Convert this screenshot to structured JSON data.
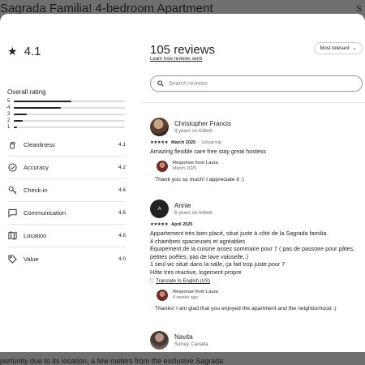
{
  "background": {
    "title": "Sagrada Familia! 4-bedroom Apartment",
    "share_label": "S",
    "bottom_text": "portunity due to its location, a few meters from the exclusive Sagrada"
  },
  "summary": {
    "overall_rating": "4.1",
    "overall_label": "Overall rating",
    "distribution": [
      {
        "stars": "5",
        "fraction": 0.52
      },
      {
        "stars": "4",
        "fraction": 0.42
      },
      {
        "stars": "3",
        "fraction": 0.12
      },
      {
        "stars": "2",
        "fraction": 0.08
      },
      {
        "stars": "1",
        "fraction": 0.03
      }
    ],
    "categories": [
      {
        "label": "Cleanliness",
        "value": "4.1",
        "icon": "spray-bottle-icon"
      },
      {
        "label": "Accuracy",
        "value": "4.2",
        "icon": "check-circle-icon"
      },
      {
        "label": "Check-in",
        "value": "4.6",
        "icon": "key-icon"
      },
      {
        "label": "Communication",
        "value": "4.6",
        "icon": "message-icon"
      },
      {
        "label": "Location",
        "value": "4.8",
        "icon": "map-icon"
      },
      {
        "label": "Value",
        "value": "4.0",
        "icon": "tag-icon"
      }
    ]
  },
  "reviews_panel": {
    "count_title": "105 reviews",
    "learn_link": "Learn how reviews work",
    "sort_label": "Most relevant",
    "search_placeholder": "Search reviews"
  },
  "reviews": [
    {
      "name": "Christopher Francis",
      "subtitle": "4 years on Airbnb",
      "stars": "★★★★★",
      "date": "March 2025",
      "trip_type": "· Group trip",
      "body": "Amazing flexible care free stay great hostess",
      "response": {
        "from": "Response from Laura",
        "when": "March 2025",
        "text": "Thank you so much! I appreciate it :)"
      }
    },
    {
      "name": "Annie",
      "initial": "A",
      "subtitle": "6 years on Airbnb",
      "stars": "★★★★★",
      "date": "April 2025",
      "body_lines": [
        "Appartement très bien placé, situé juste à côté de la Sagrada familia.",
        "4 chambres spacieuses et agréables",
        "Équipement de la cuisine assez sommaire pour 7 ( pas de passoire pour pâtes,",
        "petites poêles, pas de lave vaisselle..)",
        "1 seul wc situé dans la salle, ça fait trop juste pour 7",
        "Hôte très réactive, logement propre"
      ],
      "translate_label": "Translate to English (US)",
      "response": {
        "from": "Response from Laura",
        "when": "4 weeks ago",
        "text": "Thanks! I am glad that you enjoyed the apartment and the neighborhood :)"
      }
    },
    {
      "name": "Navita",
      "subtitle": "Surrey, Canada"
    }
  ]
}
